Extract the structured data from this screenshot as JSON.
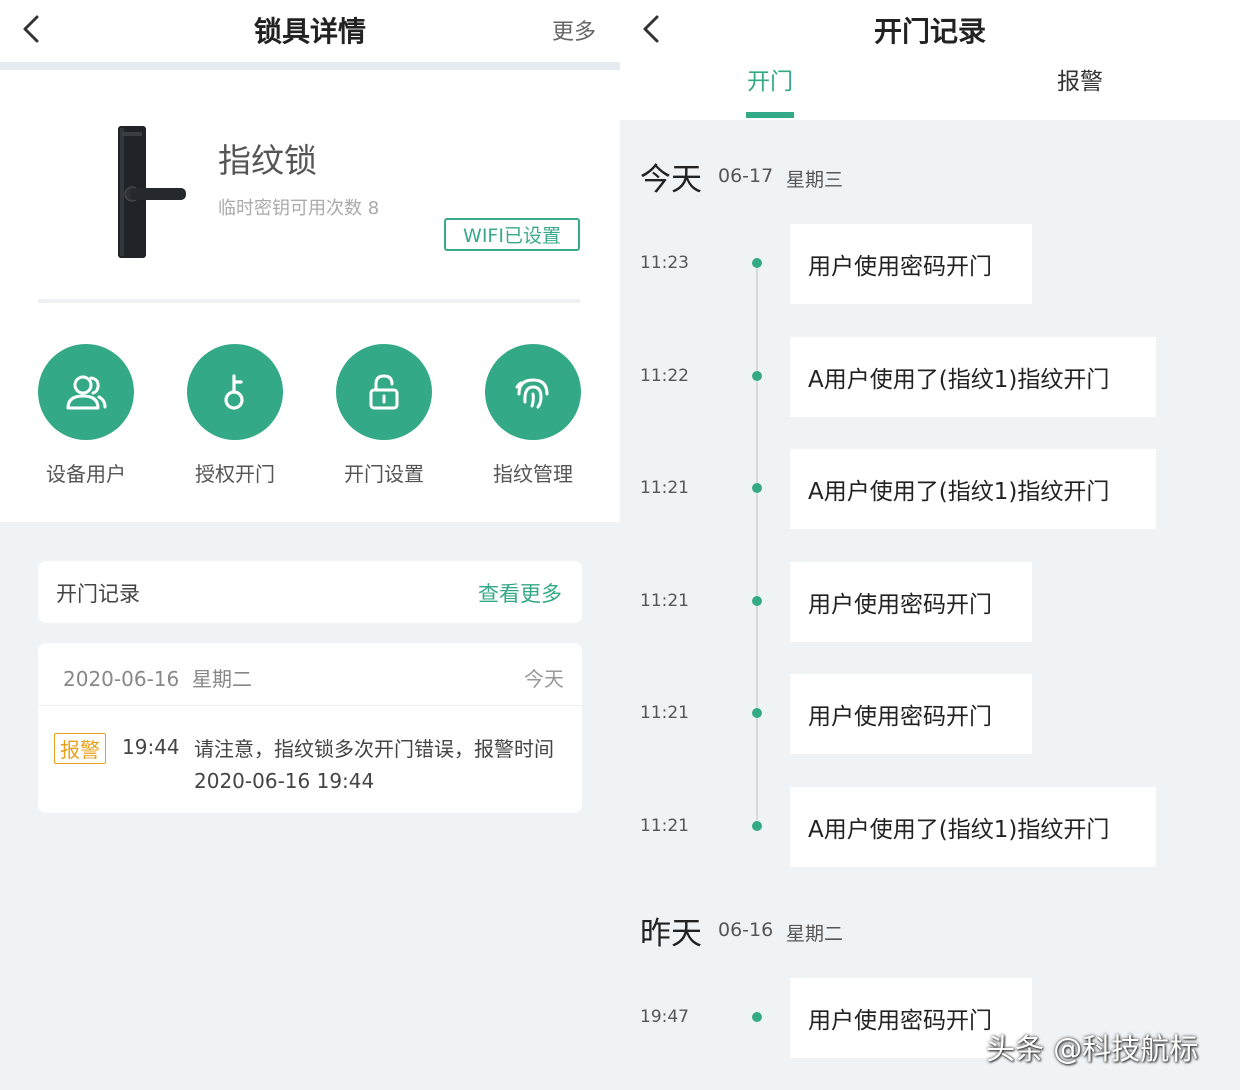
{
  "left": {
    "header": {
      "title": "锁具详情",
      "more": "更多"
    },
    "device": {
      "name": "指纹锁",
      "sub": "临时密钥可用次数 8",
      "wifi": "WIFI已设置"
    },
    "functions": [
      {
        "label": "设备用户",
        "icon": "users-icon"
      },
      {
        "label": "授权开门",
        "icon": "key-icon"
      },
      {
        "label": "开门设置",
        "icon": "lock-icon"
      },
      {
        "label": "指纹管理",
        "icon": "fingerprint-icon"
      }
    ],
    "records": {
      "title": "开门记录",
      "more": "查看更多",
      "date": "2020-06-16",
      "weekday": "星期二",
      "today": "今天",
      "alarm": {
        "badge": "报警",
        "time": "19:44",
        "message": "请注意，指纹锁多次开门错误，报警时间 2020-06-16 19:44"
      }
    }
  },
  "right": {
    "header": {
      "title": "开门记录"
    },
    "tabs": {
      "open": "开门",
      "alarm": "报警"
    },
    "today": {
      "label": "今天",
      "date": "06-17",
      "weekday": "星期三"
    },
    "yesterday": {
      "label": "昨天",
      "date": "06-16",
      "weekday": "星期二"
    },
    "entries": [
      {
        "time": "11:23",
        "text": "用户使用密码开门"
      },
      {
        "time": "11:22",
        "text": "A用户使用了(指纹1)指纹开门"
      },
      {
        "time": "11:21",
        "text": "A用户使用了(指纹1)指纹开门"
      },
      {
        "time": "11:21",
        "text": "用户使用密码开门"
      },
      {
        "time": "11:21",
        "text": "用户使用密码开门"
      },
      {
        "time": "11:21",
        "text": "A用户使用了(指纹1)指纹开门"
      }
    ],
    "yesterday_entries": [
      {
        "time": "19:47",
        "text": "用户使用密码开门"
      }
    ]
  },
  "watermark": "头条 @科技航标",
  "colors": {
    "accent": "#34a987",
    "alarm": "#e7a21b"
  }
}
